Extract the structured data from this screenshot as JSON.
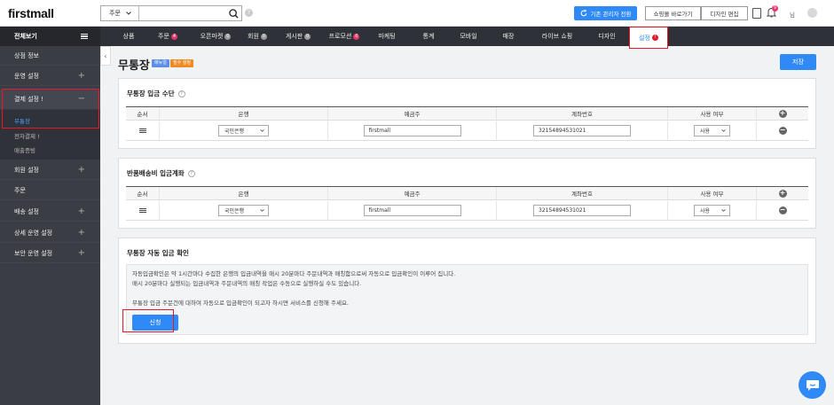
{
  "brand": {
    "logo_text": "firstmall",
    "accent": "#2f89f7",
    "alert_red": "#e5182c"
  },
  "header": {
    "search_category": "주문",
    "search_placeholder": "",
    "switch_button": "기존 관리자 전환",
    "shop_button": "쇼핑몰 바로가기",
    "design_button": "디자인 편집",
    "notification_count": "9",
    "user_name": "님"
  },
  "nav": {
    "all_menu": "전체보기",
    "items": [
      {
        "label": "상품",
        "badge": ""
      },
      {
        "label": "주문",
        "badge": "4"
      },
      {
        "label": "오픈마켓",
        "badge": "0"
      },
      {
        "label": "회원",
        "badge": "0"
      },
      {
        "label": "게시판",
        "badge": "0"
      },
      {
        "label": "프로모션",
        "badge": "0"
      },
      {
        "label": "마케팅",
        "badge": ""
      },
      {
        "label": "통계",
        "badge": ""
      },
      {
        "label": "모바일",
        "badge": ""
      },
      {
        "label": "매장",
        "badge": ""
      },
      {
        "label": "라이브 쇼핑",
        "badge": ""
      },
      {
        "label": "디자인",
        "badge": ""
      },
      {
        "label": "설정",
        "badge": "!"
      }
    ]
  },
  "sidebar": {
    "items": [
      {
        "label": "상점 정보"
      },
      {
        "label": "운영 설정"
      },
      {
        "label": "결제 설정 !"
      },
      {
        "label": "회원 설정"
      },
      {
        "label": "주문"
      },
      {
        "label": "배송 설정"
      },
      {
        "label": "상세 운영 설정"
      },
      {
        "label": "보안 운영 설정"
      }
    ],
    "sub_items": [
      {
        "label": "무통장"
      },
      {
        "label": "전자결제 !"
      },
      {
        "label": "매출증빙"
      }
    ]
  },
  "page": {
    "title": "무통장",
    "tag1": "매뉴얼",
    "tag2": "필수 설정",
    "save_button": "저장"
  },
  "section1": {
    "title": "무통장 입금 수단",
    "columns": [
      "순서",
      "은행",
      "예금주",
      "계좌번호",
      "사용 여부"
    ],
    "row": {
      "bank": "국민은행",
      "holder": "firstmall",
      "account": "32154894531021",
      "use": "사용"
    }
  },
  "section2": {
    "title": "반품배송비 입금계좌",
    "columns": [
      "순서",
      "은행",
      "예금주",
      "계좌번호",
      "사용 여부"
    ],
    "row": {
      "bank": "국민은행",
      "holder": "firstmall",
      "account": "32154894531021",
      "use": "사용"
    }
  },
  "section3": {
    "title": "무통장 자동 입금 확인",
    "line1": "자동입금확인은 약 1시간마다 수집한 은행의 입금내역을 매시 20분마다 주문내역과 매칭함으로써 자동으로 입금확인이 이루어 집니다.",
    "line2": "매시 20분마다 실행되는 입금내역과 주문내역의 매칭 작업은 수동으로 실행하실 수도 있습니다.",
    "line3": "무통장 입금 주문건에 대하여 자동으로 입금확인이 되고자 하시면 서비스를 신청해 주세요.",
    "apply_button": "신청"
  }
}
